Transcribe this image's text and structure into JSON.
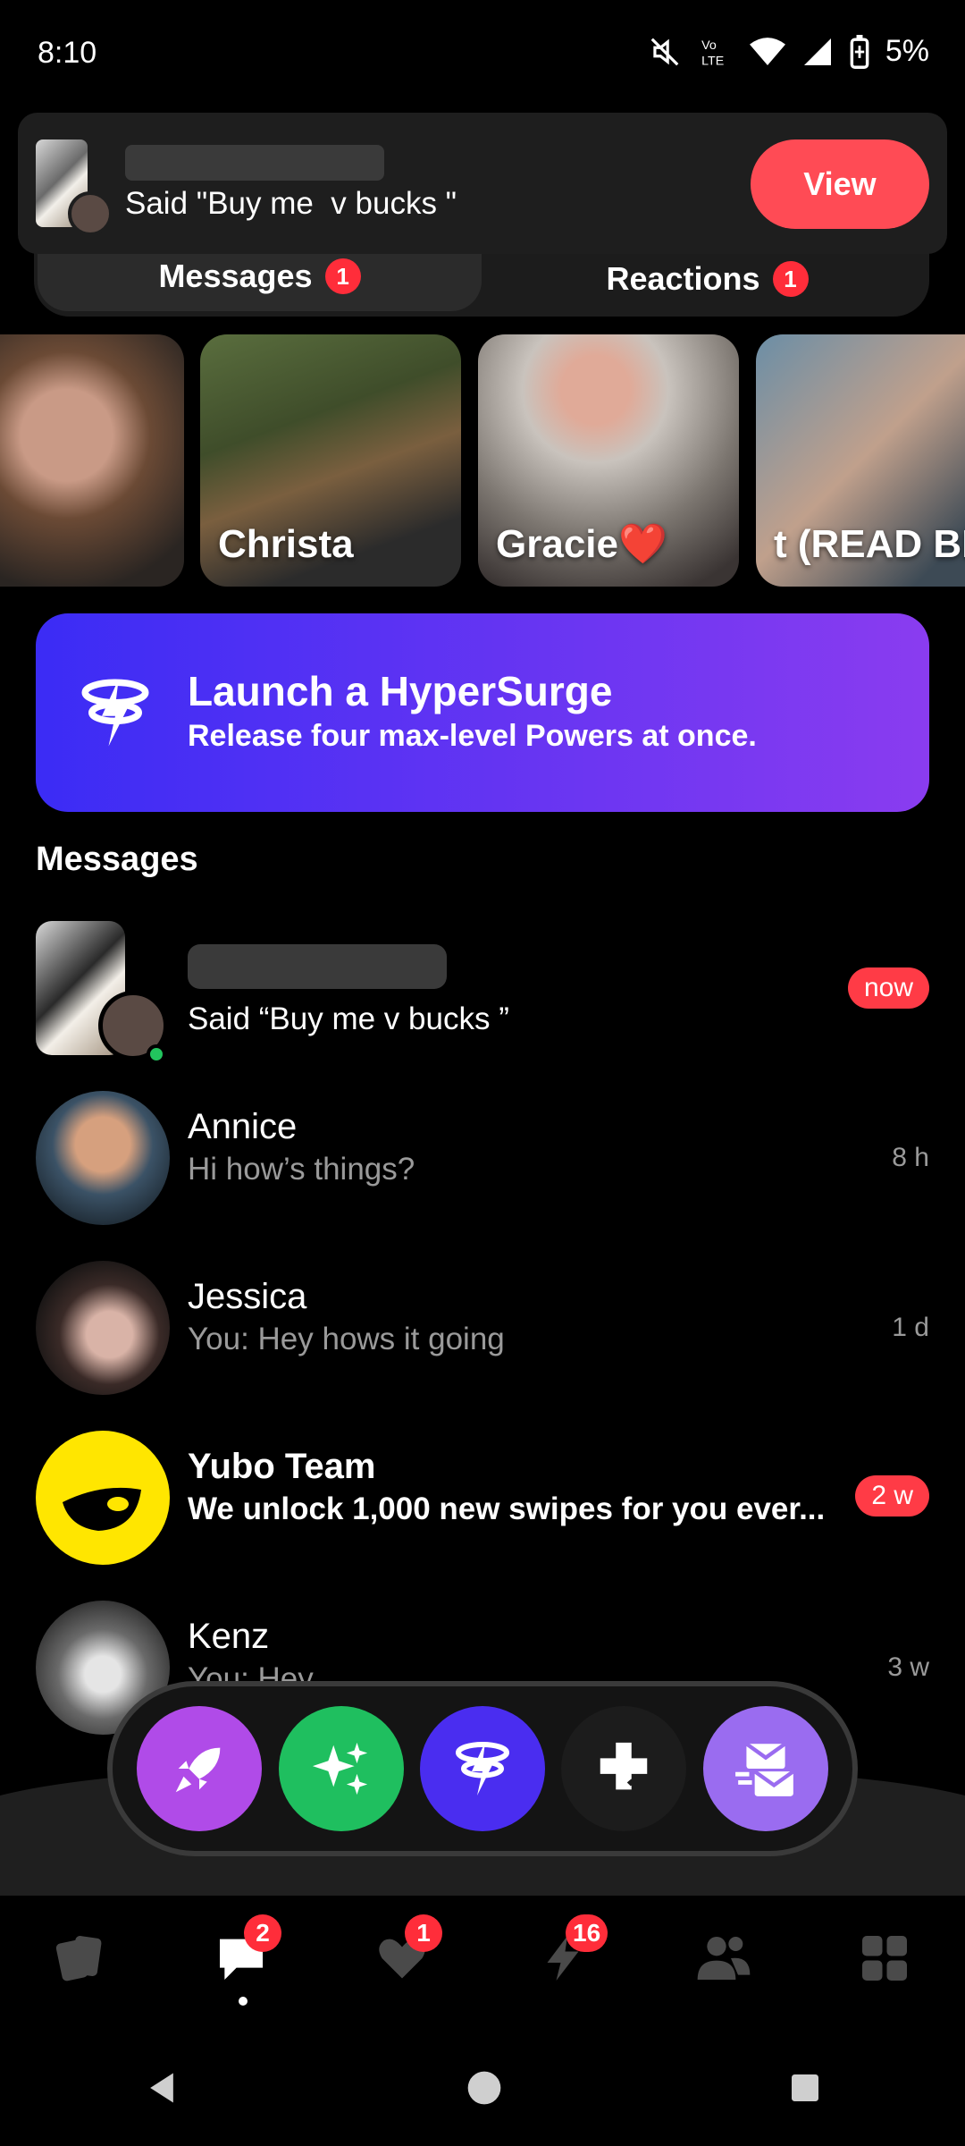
{
  "status_bar": {
    "time": "8:10",
    "battery": "5%",
    "network_label": "Vo LTE"
  },
  "banner": {
    "message": "Said \"Buy me  v bucks \"",
    "view_label": "View"
  },
  "tabs": [
    {
      "label": "Messages",
      "badge": "1",
      "active": true
    },
    {
      "label": "Reactions",
      "badge": "1",
      "active": false
    }
  ],
  "stories": [
    {
      "label": ""
    },
    {
      "label": "Christa"
    },
    {
      "label": "Gracie❤️"
    },
    {
      "label": "t (READ BI..."
    }
  ],
  "promo": {
    "title": "Launch a HyperSurge",
    "subtitle": "Release four max-level Powers at once."
  },
  "messages_section": {
    "title": "Messages",
    "items": [
      {
        "name": "",
        "preview": "Said “Buy me  v bucks ”",
        "time": "now",
        "time_highlight": true,
        "bold": false,
        "online": true
      },
      {
        "name": "Annice",
        "preview": "Hi how’s things?",
        "time": "8 h",
        "time_highlight": false,
        "bold": false
      },
      {
        "name": "Jessica",
        "preview": "You: Hey hows it going",
        "time": "1 d",
        "time_highlight": false,
        "bold": false
      },
      {
        "name": "Yubo Team",
        "preview": "We unlock 1,000 new swipes for you ever...",
        "time": "2 w",
        "time_highlight": true,
        "bold": true
      },
      {
        "name": "Kenz",
        "preview": "You: Hey",
        "time": "3 w",
        "time_highlight": false,
        "bold": false
      }
    ]
  },
  "fab_buttons": [
    {
      "icon": "rocket-icon",
      "color": "#b04be8"
    },
    {
      "icon": "sparkles-icon",
      "color": "#1fbf5f"
    },
    {
      "icon": "hypersurge-icon",
      "color": "#4a2df0"
    },
    {
      "icon": "puzzle-plus-icon",
      "color": "#1c1c1c"
    },
    {
      "icon": "envelopes-icon",
      "color": "#9a6cf0"
    }
  ],
  "bottom_nav": [
    {
      "icon": "cards-icon",
      "badge": ""
    },
    {
      "icon": "chat-bubble-icon",
      "badge": "2",
      "active": true
    },
    {
      "icon": "heart-icon",
      "badge": "1"
    },
    {
      "icon": "lightning-icon",
      "badge": "16"
    },
    {
      "icon": "people-icon",
      "badge": ""
    },
    {
      "icon": "grid-icon",
      "badge": ""
    }
  ],
  "colors": {
    "accent_red": "#ff4b55",
    "promo_start": "#3b2cf5",
    "promo_end": "#8a3cf0",
    "yubo_yellow": "#ffe600"
  }
}
